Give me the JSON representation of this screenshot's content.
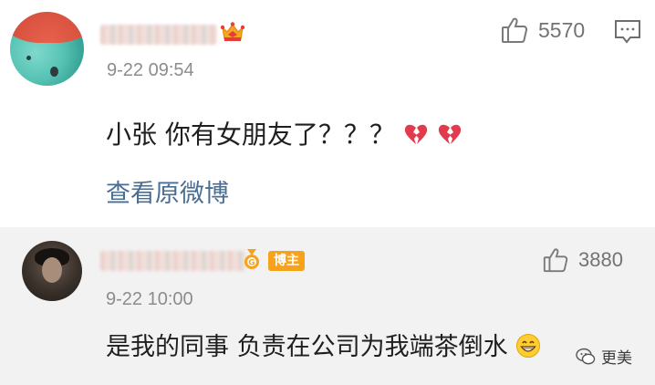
{
  "comments": [
    {
      "time": "9-22 09:54",
      "text": "小张 你有女朋友了？？？",
      "text_emoji": "broken-heart-icon x2",
      "likes": "5570",
      "link_label": "查看原微博"
    },
    {
      "time": "9-22 10:00",
      "badge": "博主",
      "text": "是我的同事 负责在公司为我端茶倒水",
      "text_emoji": "grin-icon",
      "likes": "3880"
    }
  ],
  "watermark": {
    "label": "更美"
  },
  "colors": {
    "link": "#4a6e93",
    "badge": "#f7a21b",
    "reply_bg": "#f2f2f2",
    "meta": "#8c8c8c"
  }
}
